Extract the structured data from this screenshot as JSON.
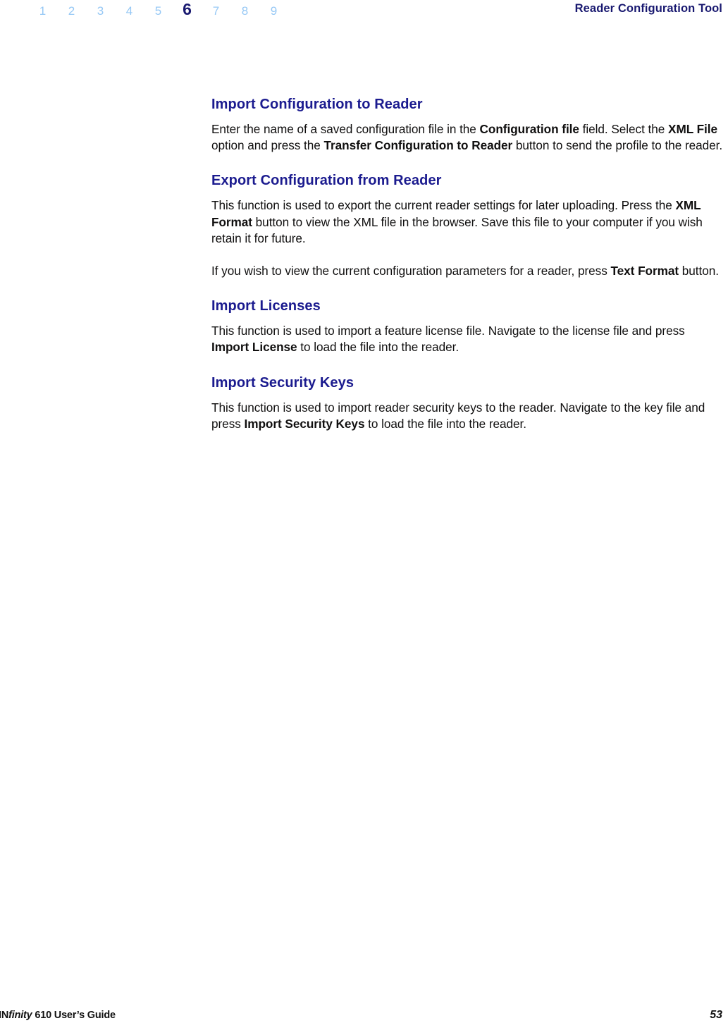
{
  "header": {
    "chapter_numbers": [
      "1",
      "2",
      "3",
      "4",
      "5",
      "6",
      "7",
      "8",
      "9"
    ],
    "current_chapter": "6",
    "title": "Reader Configuration Tool",
    "inactive_color": "#96c8f5",
    "active_color": "#191970"
  },
  "content": {
    "accent_color": "#1b1b8f",
    "blocks": [
      {
        "heading": "Import Configuration to Reader",
        "paragraphs": [
          {
            "runs": [
              {
                "text": "Enter the name of a saved configuration file in the ",
                "bold": false
              },
              {
                "text": "Configuration file",
                "bold": true
              },
              {
                "text": " field. Select the ",
                "bold": false
              },
              {
                "text": "XML File",
                "bold": true
              },
              {
                "text": " option and press the ",
                "bold": false
              },
              {
                "text": "Transfer Configuration to Reader",
                "bold": true
              },
              {
                "text": " button to send the profile to the reader.",
                "bold": false
              }
            ]
          }
        ]
      },
      {
        "heading": "Export Configuration from Reader",
        "paragraphs": [
          {
            "runs": [
              {
                "text": "This function is used to export the current reader settings for later uploading. Press the ",
                "bold": false
              },
              {
                "text": "XML Format",
                "bold": true
              },
              {
                "text": " button to view the XML file in the browser. Save this file to your computer if you wish retain it for future.",
                "bold": false
              }
            ]
          },
          {
            "runs": [
              {
                "text": "If you wish to view the current configuration parameters for a reader, press ",
                "bold": false
              },
              {
                "text": "Text Format",
                "bold": true
              },
              {
                "text": " button.",
                "bold": false
              }
            ]
          }
        ]
      },
      {
        "heading": "Import Licenses",
        "paragraphs": [
          {
            "runs": [
              {
                "text": "This function is used to import a feature license file. Navigate to the license file and press ",
                "bold": false
              },
              {
                "text": "Import License",
                "bold": true
              },
              {
                "text": " to load the file into the reader.",
                "bold": false
              }
            ]
          }
        ]
      },
      {
        "heading": "Import Security Keys",
        "paragraphs": [
          {
            "runs": [
              {
                "text": "This function is used to import reader security keys to the reader. Navigate to the key file and press ",
                "bold": false
              },
              {
                "text": "Import Security Keys",
                "bold": true
              },
              {
                "text": " to load the file into the reader.",
                "bold": false
              }
            ]
          }
        ]
      }
    ]
  },
  "footer": {
    "doc_title_parts": [
      {
        "text": "IN",
        "italic": false
      },
      {
        "text": "finity",
        "italic": true
      },
      {
        "text": " 610 User’s Guide",
        "italic": false
      }
    ],
    "page_number": "53"
  }
}
